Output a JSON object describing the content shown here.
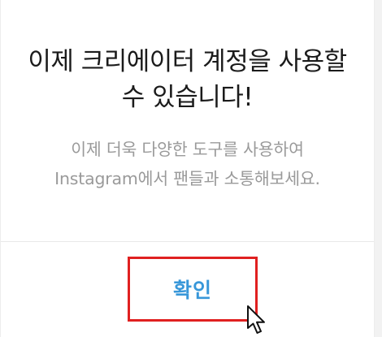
{
  "dialog": {
    "title_line1": "이제 크리에이터 계정을 사용할",
    "title_line2": "수 있습니다!",
    "message_line1": "이제 더욱 다양한 도구를 사용하여",
    "message_line2": "Instagram에서 팬들과 소통해보세요.",
    "confirm_label": "확인"
  },
  "colors": {
    "accent": "#3897d9",
    "highlight_box": "#e02020"
  },
  "icons": {
    "cursor": "mouse-pointer-icon"
  }
}
